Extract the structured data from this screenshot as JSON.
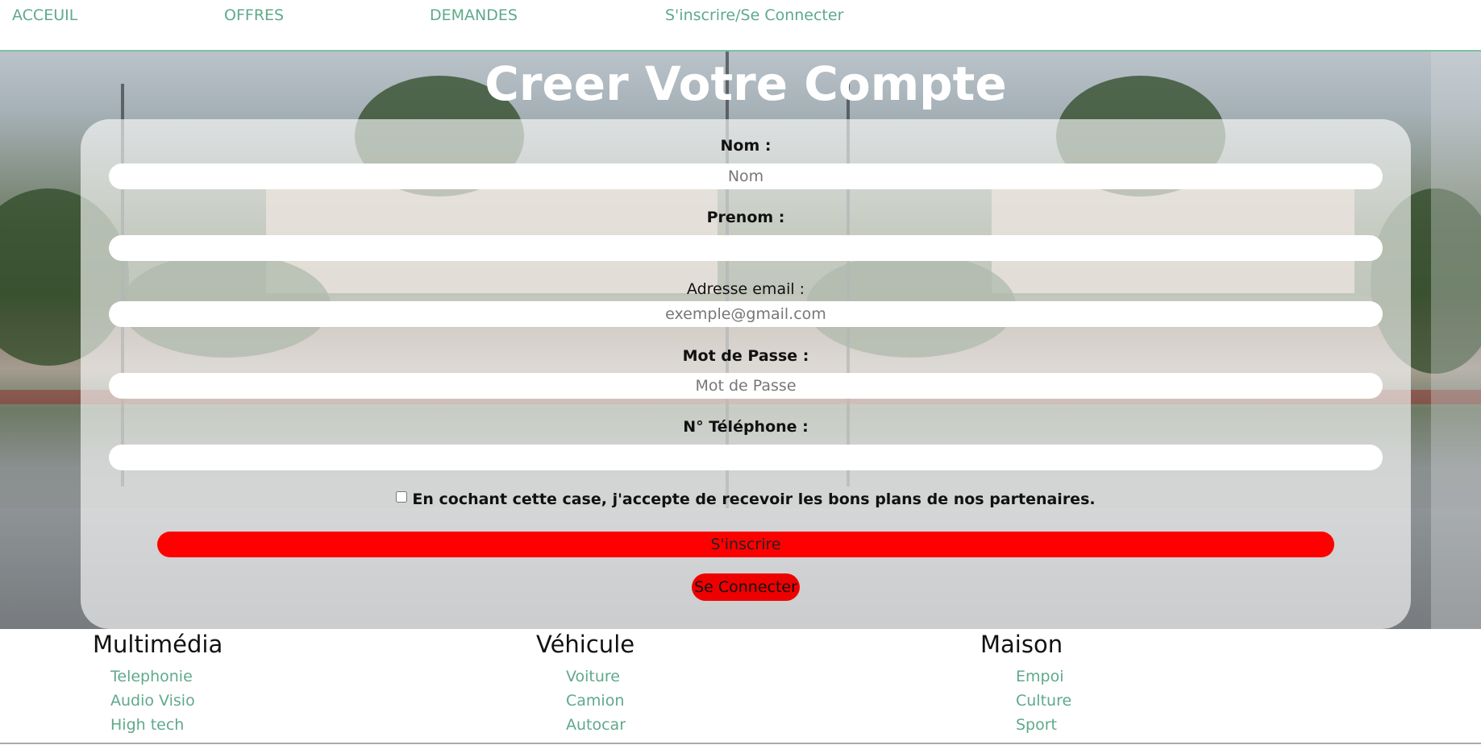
{
  "nav": {
    "home": "ACCEUIL",
    "offers": "OFFRES",
    "requests": "DEMANDES",
    "login": "S'inscrire/Se Connecter"
  },
  "form": {
    "title": "Creer Votre Compte",
    "nom_label": "Nom :",
    "nom_placeholder": "Nom",
    "prenom_label": "Prenom :",
    "prenom_placeholder": "",
    "email_label": "Adresse email :",
    "email_placeholder": "exemple@gmail.com",
    "password_label": "Mot de Passe :",
    "password_placeholder": "Mot de Passe",
    "phone_label": "N° Téléphone :",
    "phone_placeholder": "",
    "checkbox_label": "En cochant cette case, j'accepte de recevoir les bons plans de nos partenaires.",
    "checkbox_checked": false,
    "submit_label": "S'inscrire",
    "connect_label": "Se Connecter"
  },
  "categories": [
    {
      "title": "Multimédia",
      "items": [
        "Telephonie",
        "Audio Visio",
        "High tech"
      ]
    },
    {
      "title": "Véhicule",
      "items": [
        "Voiture",
        "Camion",
        "Autocar"
      ]
    },
    {
      "title": "Maison",
      "items": [
        "Empoi",
        "Culture",
        "Sport"
      ]
    }
  ],
  "colors": {
    "accent_green": "#5fa98b",
    "button_red": "#ff0000"
  }
}
